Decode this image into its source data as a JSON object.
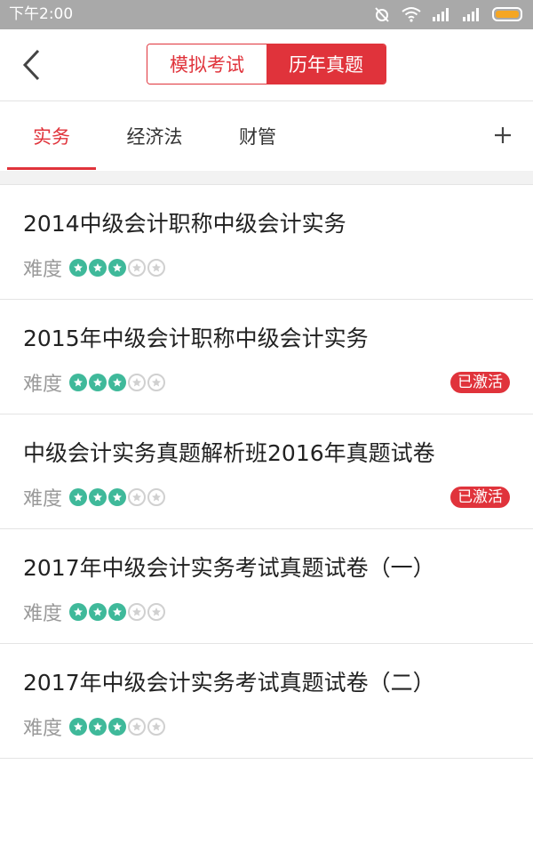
{
  "status_bar": {
    "time": "下午2:00"
  },
  "header": {
    "segments": [
      {
        "label": "模拟考试",
        "active": false
      },
      {
        "label": "历年真题",
        "active": true
      }
    ]
  },
  "tabs": [
    {
      "label": "实务",
      "active": true
    },
    {
      "label": "经济法",
      "active": false
    },
    {
      "label": "财管",
      "active": false
    }
  ],
  "colors": {
    "accent": "#e0333b",
    "star": "#3fb99a",
    "status_bar": "#a9a9a9"
  },
  "items": [
    {
      "title": "2014中级会计职称中级会计实务",
      "difficulty_label": "难度",
      "difficulty": 3,
      "difficulty_max": 5,
      "badge": ""
    },
    {
      "title": "2015年中级会计职称中级会计实务",
      "difficulty_label": "难度",
      "difficulty": 3,
      "difficulty_max": 5,
      "badge": "已激活"
    },
    {
      "title": "中级会计实务真题解析班2016年真题试卷",
      "difficulty_label": "难度",
      "difficulty": 3,
      "difficulty_max": 5,
      "badge": "已激活"
    },
    {
      "title": "2017年中级会计实务考试真题试卷（一）",
      "difficulty_label": "难度",
      "difficulty": 3,
      "difficulty_max": 5,
      "badge": ""
    },
    {
      "title": "2017年中级会计实务考试真题试卷（二）",
      "difficulty_label": "难度",
      "difficulty": 3,
      "difficulty_max": 5,
      "badge": ""
    }
  ]
}
